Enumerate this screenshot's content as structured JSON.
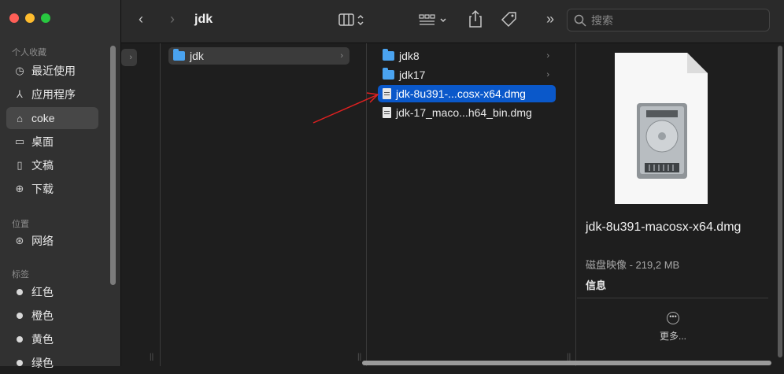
{
  "sidebar": {
    "favorites_title": "个人收藏",
    "favorites": [
      {
        "label": "最近使用",
        "icon": "clock-icon"
      },
      {
        "label": "应用程序",
        "icon": "apps-icon"
      },
      {
        "label": "coke",
        "icon": "home-icon"
      },
      {
        "label": "桌面",
        "icon": "desktop-icon"
      },
      {
        "label": "文稿",
        "icon": "document-icon"
      },
      {
        "label": "下载",
        "icon": "download-icon"
      }
    ],
    "locations_title": "位置",
    "locations": [
      {
        "label": "网络",
        "icon": "globe-icon"
      }
    ],
    "tags_title": "标签",
    "tags": [
      {
        "label": "红色"
      },
      {
        "label": "橙色"
      },
      {
        "label": "黄色"
      },
      {
        "label": "绿色"
      }
    ]
  },
  "toolbar": {
    "title": "jdk",
    "search_placeholder": "搜索"
  },
  "columns": {
    "col2": [
      {
        "label": "jdk",
        "type": "folder"
      }
    ],
    "col3": [
      {
        "label": "jdk8",
        "type": "folder"
      },
      {
        "label": "jdk17",
        "type": "folder"
      },
      {
        "label": "jdk-8u391-...cosx-x64.dmg",
        "type": "file"
      },
      {
        "label": "jdk-17_maco...h64_bin.dmg",
        "type": "file"
      }
    ]
  },
  "preview": {
    "name": "jdk-8u391-macosx-x64.dmg",
    "meta": "磁盘映像 - 219,2 MB",
    "info": "信息",
    "more": "更多..."
  },
  "colors": {
    "selection": "#0a58ca",
    "folder": "#4aa3f0",
    "arrow": "#e02020"
  }
}
